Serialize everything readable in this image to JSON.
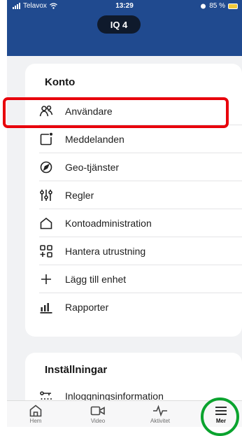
{
  "status_bar": {
    "carrier": "Telavox",
    "time": "13:29",
    "battery": "85 %"
  },
  "header": {
    "device": "IQ 4"
  },
  "konto": {
    "title": "Konto",
    "items": [
      {
        "label": "Användare",
        "icon": "users-icon"
      },
      {
        "label": "Meddelanden",
        "icon": "messages-icon"
      },
      {
        "label": "Geo-tjänster",
        "icon": "geo-icon"
      },
      {
        "label": "Regler",
        "icon": "rules-icon"
      },
      {
        "label": "Kontoadministration",
        "icon": "home-icon"
      },
      {
        "label": "Hantera utrustning",
        "icon": "equipment-icon"
      },
      {
        "label": "Lägg till enhet",
        "icon": "plus-icon"
      },
      {
        "label": "Rapporter",
        "icon": "reports-icon"
      }
    ]
  },
  "settings": {
    "title": "Inställningar",
    "items": [
      {
        "label": "Inloggningsinformation",
        "icon": "login-icon"
      }
    ]
  },
  "tabs": [
    {
      "label": "Hem",
      "icon": "home-icon"
    },
    {
      "label": "Video",
      "icon": "video-icon"
    },
    {
      "label": "Aktivitet",
      "icon": "activity-icon"
    },
    {
      "label": "Mer",
      "icon": "menu-icon",
      "active": true
    }
  ],
  "annotations": {
    "highlight_color": "#e8000b",
    "circle_color": "#0aa32e"
  },
  "colors": {
    "header": "#204a8f",
    "background": "#f1f2f4"
  }
}
